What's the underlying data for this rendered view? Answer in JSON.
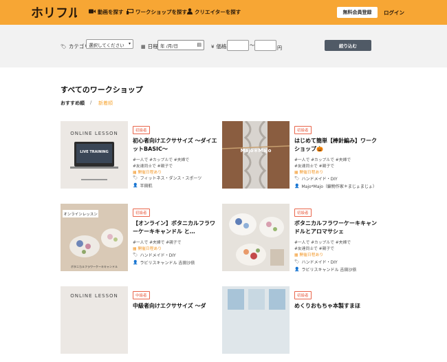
{
  "header": {
    "logo_text": "ホリフル",
    "nav": [
      {
        "label": "動画を探す",
        "icon": "video-camera-icon"
      },
      {
        "label": "ワークショップを探す",
        "icon": "chalkboard-icon"
      },
      {
        "label": "クリエイターを探す",
        "icon": "person-icon"
      }
    ],
    "register_label": "無料会員登録",
    "login_label": "ログイン"
  },
  "filters": {
    "category_label": "カテゴリ",
    "category_value": "選択してください",
    "date_label": "日程",
    "date_placeholder": "年 /月/日",
    "price_label": "価格",
    "price_separator": "〜",
    "price_unit": "円",
    "submit_label": "絞り込む"
  },
  "main": {
    "title": "すべてのワークショップ",
    "sort": {
      "recommended": "おすすめ順",
      "separator": "/",
      "newest": "新着順"
    }
  },
  "cards": [
    {
      "badge": "初級者",
      "title": "初心者向けエクササイズ 〜ダイエットBASIC〜",
      "tags": [
        "#一人で #カップルで #夫婦で",
        "#友達同士で #親子で"
      ],
      "session": "開催日程あり",
      "category": "フィットネス・ダンス・スポーツ",
      "creator": "半田航",
      "thumb_caption": "ONLINE LESSON",
      "thumb_screen": "LIVE TRAINING"
    },
    {
      "badge": "初級者",
      "title": "はじめて簡単【棒針編み】ワークショップ🎃",
      "tags": [
        "#一人で #カップルで #夫婦で",
        "#友達同士で #親子で"
      ],
      "session": "開催日程あり",
      "category": "ハンドメイド・DIY",
      "creator": "Majo*Majo（編物作家＊まじょまじょ）",
      "thumb_caption": "Majo＊Majo"
    },
    {
      "badge": "初級者",
      "title": "【オンライン】ボタニカルフラワーケーキキャンドル と…",
      "tags": [
        "#一人で #夫婦で #親子で"
      ],
      "session": "開催日程あり",
      "category": "ハンドメイド・DIY",
      "creator": "ラビリスキャンドル 吉田沙依",
      "thumb_caption": "オンラインレッスン",
      "thumb_sub": "ボタニカルフラワーケーキキャンドル"
    },
    {
      "badge": "初級者",
      "title": "ボタニカルフラワーケーキキャンドルとアロマサシェ",
      "tags": [
        "#一人で #カップルで #夫婦で",
        "#友達同士で #親子で"
      ],
      "session": "開催日程あり",
      "category": "ハンドメイド・DIY",
      "creator": "ラビリスキャンドル 吉田沙依"
    },
    {
      "badge": "中級者",
      "title": "中級者向けエクササイズ 〜ダ",
      "thumb_caption": "ONLINE LESSON"
    },
    {
      "badge": "初級者",
      "title": "めくりおもちゃ本製すまほ"
    }
  ],
  "colors": {
    "brand": "#f7a634",
    "badge": "#e9644a",
    "button_dark": "#505a66"
  }
}
